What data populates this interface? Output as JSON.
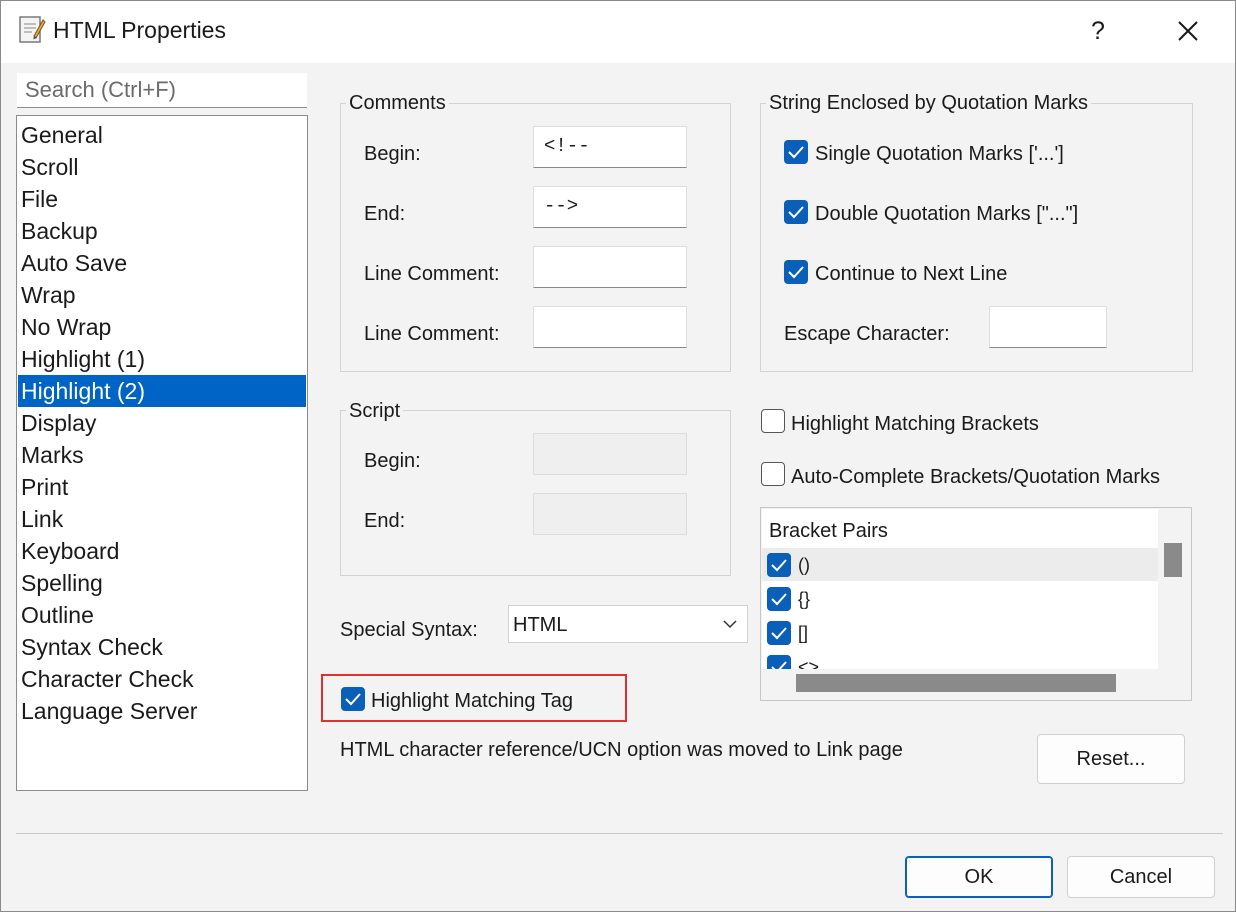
{
  "window": {
    "title": "HTML Properties",
    "help_label": "?",
    "close_label": "✕"
  },
  "search": {
    "placeholder": "Search (Ctrl+F)"
  },
  "nav": {
    "items": [
      "General",
      "Scroll",
      "File",
      "Backup",
      "Auto Save",
      "Wrap",
      "No Wrap",
      "Highlight (1)",
      "Highlight (2)",
      "Display",
      "Marks",
      "Print",
      "Link",
      "Keyboard",
      "Spelling",
      "Outline",
      "Syntax Check",
      "Character Check",
      "Language Server"
    ],
    "selected": "Highlight (2)"
  },
  "comments": {
    "title": "Comments",
    "begin_label": "Begin:",
    "begin_value": "<!--",
    "end_label": "End:",
    "end_value": "-->",
    "line_comment_label_1": "Line Comment:",
    "line_comment_value_1": "",
    "line_comment_label_2": "Line Comment:",
    "line_comment_value_2": ""
  },
  "script": {
    "title": "Script",
    "begin_label": "Begin:",
    "begin_value": "",
    "end_label": "End:",
    "end_value": ""
  },
  "string_enclosed": {
    "title": "String Enclosed by Quotation Marks",
    "single_label": "Single Quotation Marks ['...']",
    "single_checked": true,
    "double_label": "Double Quotation Marks [\"...\"]",
    "double_checked": true,
    "continue_label": "Continue to Next Line",
    "continue_checked": true,
    "escape_label": "Escape Character:",
    "escape_value": ""
  },
  "highlight_brackets": {
    "label": "Highlight Matching Brackets",
    "checked": false
  },
  "auto_complete": {
    "label": "Auto-Complete Brackets/Quotation Marks",
    "checked": false
  },
  "bracket_pairs": {
    "header": "Bracket Pairs",
    "items": [
      {
        "label": "()",
        "checked": true
      },
      {
        "label": "{}",
        "checked": true
      },
      {
        "label": "[]",
        "checked": true
      },
      {
        "label": "<>",
        "checked": true
      }
    ]
  },
  "special_syntax": {
    "label": "Special Syntax:",
    "value": "HTML"
  },
  "highlight_tag": {
    "label": "Highlight Matching Tag",
    "checked": true
  },
  "note": "HTML character reference/UCN option was moved to Link page",
  "buttons": {
    "reset": "Reset...",
    "ok": "OK",
    "cancel": "Cancel"
  },
  "colors": {
    "accent": "#0063c6",
    "checkbox": "#0a5fb8",
    "annotation_box": "#e03030"
  }
}
